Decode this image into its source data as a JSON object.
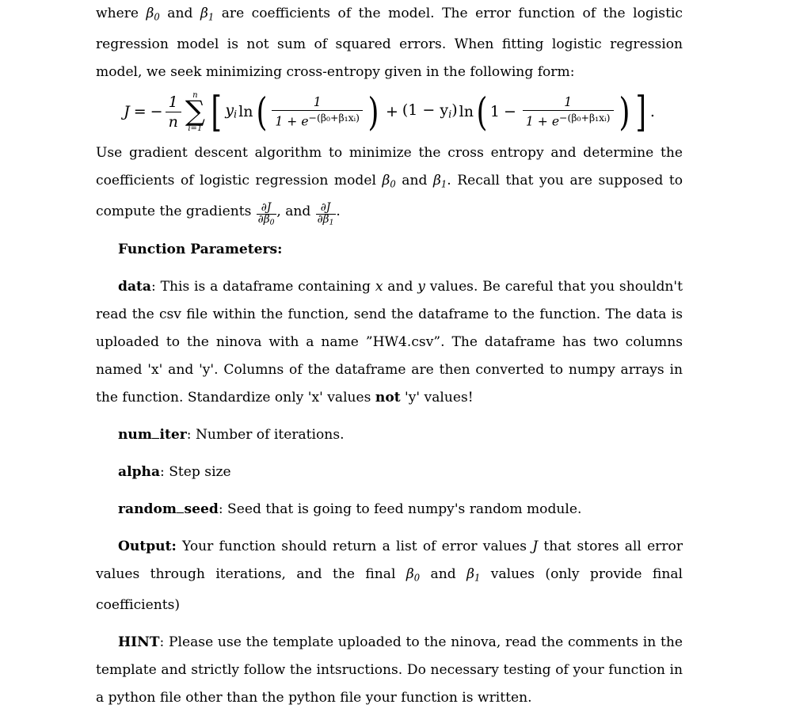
{
  "document": {
    "type": "assignment-problem-statement",
    "paragraphs": {
      "intro": {
        "lead": "where ",
        "after_b0": " and ",
        "after_b1": " are coefficients of the model. The error function of the logistic regression model is not sum of squared errors. When fitting logistic regression model, we seek minimizing cross-entropy given in the following form:"
      },
      "gradient_instructions": {
        "part1": "Use gradient descent algorithm to minimize the cross entropy and determine the coefficients of logistic regression model ",
        "part2": " and ",
        "part3": ". Recall that you are supposed to compute the gradients ",
        "part4": ", and ",
        "part5": "."
      },
      "data": {
        "label": "data",
        "text_a": ": This is a dataframe containing ",
        "text_b": " and ",
        "text_c": " values. Be careful that you shouldn't read the csv file within the function, send the dataframe to the function. The data is uploaded to the ninova with a name ",
        "filename": "”HW4.csv”",
        "text_d": ". The dataframe has two columns named 'x' and 'y'. Columns of the dataframe are then converted to numpy arrays in the function. Standardize only 'x' values ",
        "emphasis": "not",
        "text_e": " 'y' values!"
      },
      "num_iter": {
        "label_pre": "num",
        "label_post": "iter",
        "text": ": Number of iterations."
      },
      "alpha": {
        "label": "alpha",
        "text": ": Step size"
      },
      "random_seed": {
        "label_pre": "random",
        "label_post": "seed",
        "text": ": Seed that is going to feed numpy's random module."
      },
      "output": {
        "label": "Output:",
        "text_a": " Your function should return a list of error values ",
        "text_b": " that stores all error values through iterations, and the final ",
        "text_c": " and ",
        "text_d": " values (only provide final coefficients)"
      },
      "hint": {
        "label": "HINT",
        "text": ": Please use the template uploaded to the ninova, read the comments in the template and strictly follow the intsructions. Do necessary testing of your function in a python file other than the python file your function is written."
      }
    },
    "headings": {
      "function_parameters": "Function Parameters:"
    },
    "symbols": {
      "J": "J",
      "n": "n",
      "i": "i",
      "x": "x",
      "y": "y",
      "e": "e",
      "beta": "β",
      "sub0": "0",
      "sub1": "1",
      "sum_lower": "i=1",
      "sum_upper": "n",
      "sigma": "∑",
      "ln": "ln",
      "one": "1",
      "minus": "−",
      "plus": "+",
      "equals": "=",
      "period": ".",
      "lparen": "(",
      "rparen": ")",
      "lbracket": "[",
      "rbracket": "]"
    },
    "equation": {
      "latex": "J = -\\frac{1}{n}\\sum_{i=1}^{n}\\left[y_i \\ln\\left(\\frac{1}{1+e^{-(\\beta_0+\\beta_1 x_i)}}\\right) + (1-y_i)\\ln\\left(1-\\frac{1}{1+e^{-(\\beta_0+\\beta_1 x_i)}}\\right)\\right].",
      "exponent": "−(β₀+β₁xᵢ)",
      "term_one_minus_yi": "(1 − y",
      "term_close": ")"
    },
    "colors": {
      "page_background": "#ffffff",
      "text": "#000000"
    }
  }
}
